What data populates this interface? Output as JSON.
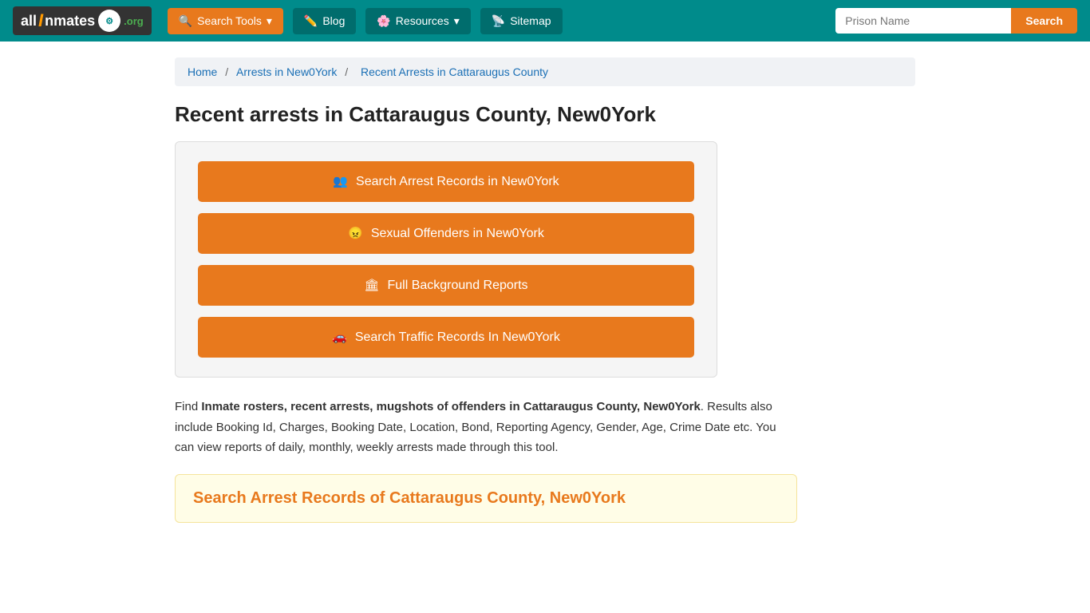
{
  "header": {
    "logo_text": "allInmates.org",
    "logo_all": "all",
    "logo_i": "I",
    "logo_nmates": "nmates",
    "logo_dotorg": ".org",
    "nav": [
      {
        "id": "search-tools",
        "label": "Search Tools",
        "icon": "search-icon",
        "dropdown": true
      },
      {
        "id": "blog",
        "label": "Blog",
        "icon": "blog-icon",
        "dropdown": false
      },
      {
        "id": "resources",
        "label": "Resources",
        "icon": "resources-icon",
        "dropdown": true
      },
      {
        "id": "sitemap",
        "label": "Sitemap",
        "icon": "sitemap-icon",
        "dropdown": false
      }
    ],
    "search_placeholder": "Prison Name",
    "search_button_label": "Search"
  },
  "breadcrumb": {
    "items": [
      {
        "label": "Home",
        "href": "#"
      },
      {
        "label": "Arrests in New0York",
        "href": "#"
      },
      {
        "label": "Recent Arrests in Cattaraugus County",
        "current": true
      }
    ]
  },
  "page": {
    "title": "Recent arrests in Cattaraugus County, New0York",
    "action_buttons": [
      {
        "id": "arrest-records",
        "icon": "people-icon",
        "label": "Search Arrest Records in New0York"
      },
      {
        "id": "sexual-offenders",
        "icon": "angry-icon",
        "label": "Sexual Offenders in New0York"
      },
      {
        "id": "background-reports",
        "icon": "building-icon",
        "label": "Full Background Reports"
      },
      {
        "id": "traffic-records",
        "icon": "car-icon",
        "label": "Search Traffic Records In New0York"
      }
    ],
    "description_intro": "Find ",
    "description_bold": "Inmate rosters, recent arrests, mugshots of offenders in Cattaraugus County, New0York",
    "description_rest": ". Results also include Booking Id, Charges, Booking Date, Location, Bond, Reporting Agency, Gender, Age, Crime Date etc. You can view reports of daily, monthly, weekly arrests made through this tool.",
    "search_records_title": "Search Arrest Records of Cattaraugus County, New0York"
  }
}
